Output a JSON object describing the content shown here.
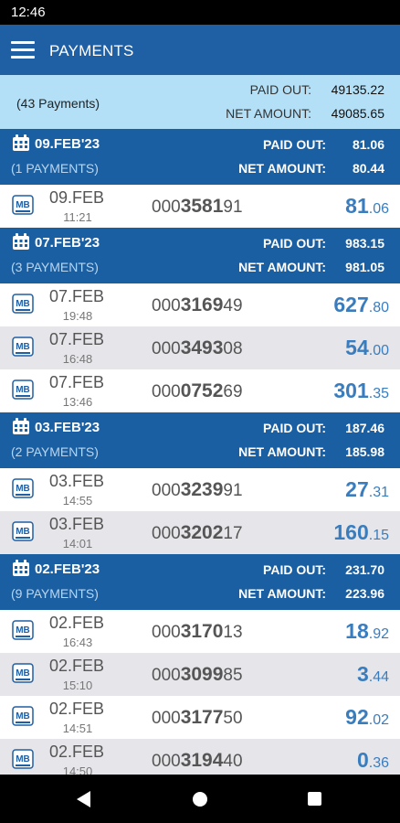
{
  "status": {
    "time": "12:46"
  },
  "appbar": {
    "title": "PAYMENTS"
  },
  "summary": {
    "count": "(43 Payments)",
    "paid_out_label": "PAID OUT:",
    "paid_out": "49135.22",
    "net_label": "NET AMOUNT:",
    "net": "49085.65"
  },
  "groups": [
    {
      "date": "09.FEB'23",
      "payments": "(1 PAYMENTS)",
      "paid_out_label": "PAID OUT:",
      "paid_out": "81.06",
      "net_label": "NET AMOUNT:",
      "net": "80.44",
      "rows": [
        {
          "date": "09.FEB",
          "time": "11:21",
          "ref_pre": "000",
          "ref_mid": "3581",
          "ref_post": "91",
          "amt_int": "81",
          "amt_dec": ".06"
        }
      ]
    },
    {
      "date": "07.FEB'23",
      "payments": "(3 PAYMENTS)",
      "paid_out_label": "PAID OUT:",
      "paid_out": "983.15",
      "net_label": "NET AMOUNT:",
      "net": "981.05",
      "rows": [
        {
          "date": "07.FEB",
          "time": "19:48",
          "ref_pre": "000",
          "ref_mid": "3169",
          "ref_post": "49",
          "amt_int": "627",
          "amt_dec": ".80"
        },
        {
          "date": "07.FEB",
          "time": "16:48",
          "ref_pre": "000",
          "ref_mid": "3493",
          "ref_post": "08",
          "amt_int": "54",
          "amt_dec": ".00"
        },
        {
          "date": "07.FEB",
          "time": "13:46",
          "ref_pre": "000",
          "ref_mid": "0752",
          "ref_post": "69",
          "amt_int": "301",
          "amt_dec": ".35"
        }
      ]
    },
    {
      "date": "03.FEB'23",
      "payments": "(2 PAYMENTS)",
      "paid_out_label": "PAID OUT:",
      "paid_out": "187.46",
      "net_label": "NET AMOUNT:",
      "net": "185.98",
      "rows": [
        {
          "date": "03.FEB",
          "time": "14:55",
          "ref_pre": "000",
          "ref_mid": "3239",
          "ref_post": "91",
          "amt_int": "27",
          "amt_dec": ".31"
        },
        {
          "date": "03.FEB",
          "time": "14:01",
          "ref_pre": "000",
          "ref_mid": "3202",
          "ref_post": "17",
          "amt_int": "160",
          "amt_dec": ".15"
        }
      ]
    },
    {
      "date": "02.FEB'23",
      "payments": "(9 PAYMENTS)",
      "paid_out_label": "PAID OUT:",
      "paid_out": "231.70",
      "net_label": "NET AMOUNT:",
      "net": "223.96",
      "rows": [
        {
          "date": "02.FEB",
          "time": "16:43",
          "ref_pre": "000",
          "ref_mid": "3170",
          "ref_post": "13",
          "amt_int": "18",
          "amt_dec": ".92"
        },
        {
          "date": "02.FEB",
          "time": "15:10",
          "ref_pre": "000",
          "ref_mid": "3099",
          "ref_post": "85",
          "amt_int": "3",
          "amt_dec": ".44"
        },
        {
          "date": "02.FEB",
          "time": "14:51",
          "ref_pre": "000",
          "ref_mid": "3177",
          "ref_post": "50",
          "amt_int": "92",
          "amt_dec": ".02"
        },
        {
          "date": "02.FEB",
          "time": "14:50",
          "ref_pre": "000",
          "ref_mid": "3194",
          "ref_post": "40",
          "amt_int": "0",
          "amt_dec": ".36"
        }
      ]
    }
  ],
  "icons": {
    "menu": "menu-icon",
    "calendar": "calendar-icon",
    "multibanco": "multibanco-icon",
    "back": "back-icon",
    "home": "home-icon",
    "recents": "recents-icon"
  },
  "colors": {
    "appbar": "#1f5fa3",
    "group_header": "#1a5fa2",
    "summary_bg": "#b4e0f7",
    "amount": "#3a7dbf",
    "alt_row": "#e6e6ea"
  }
}
